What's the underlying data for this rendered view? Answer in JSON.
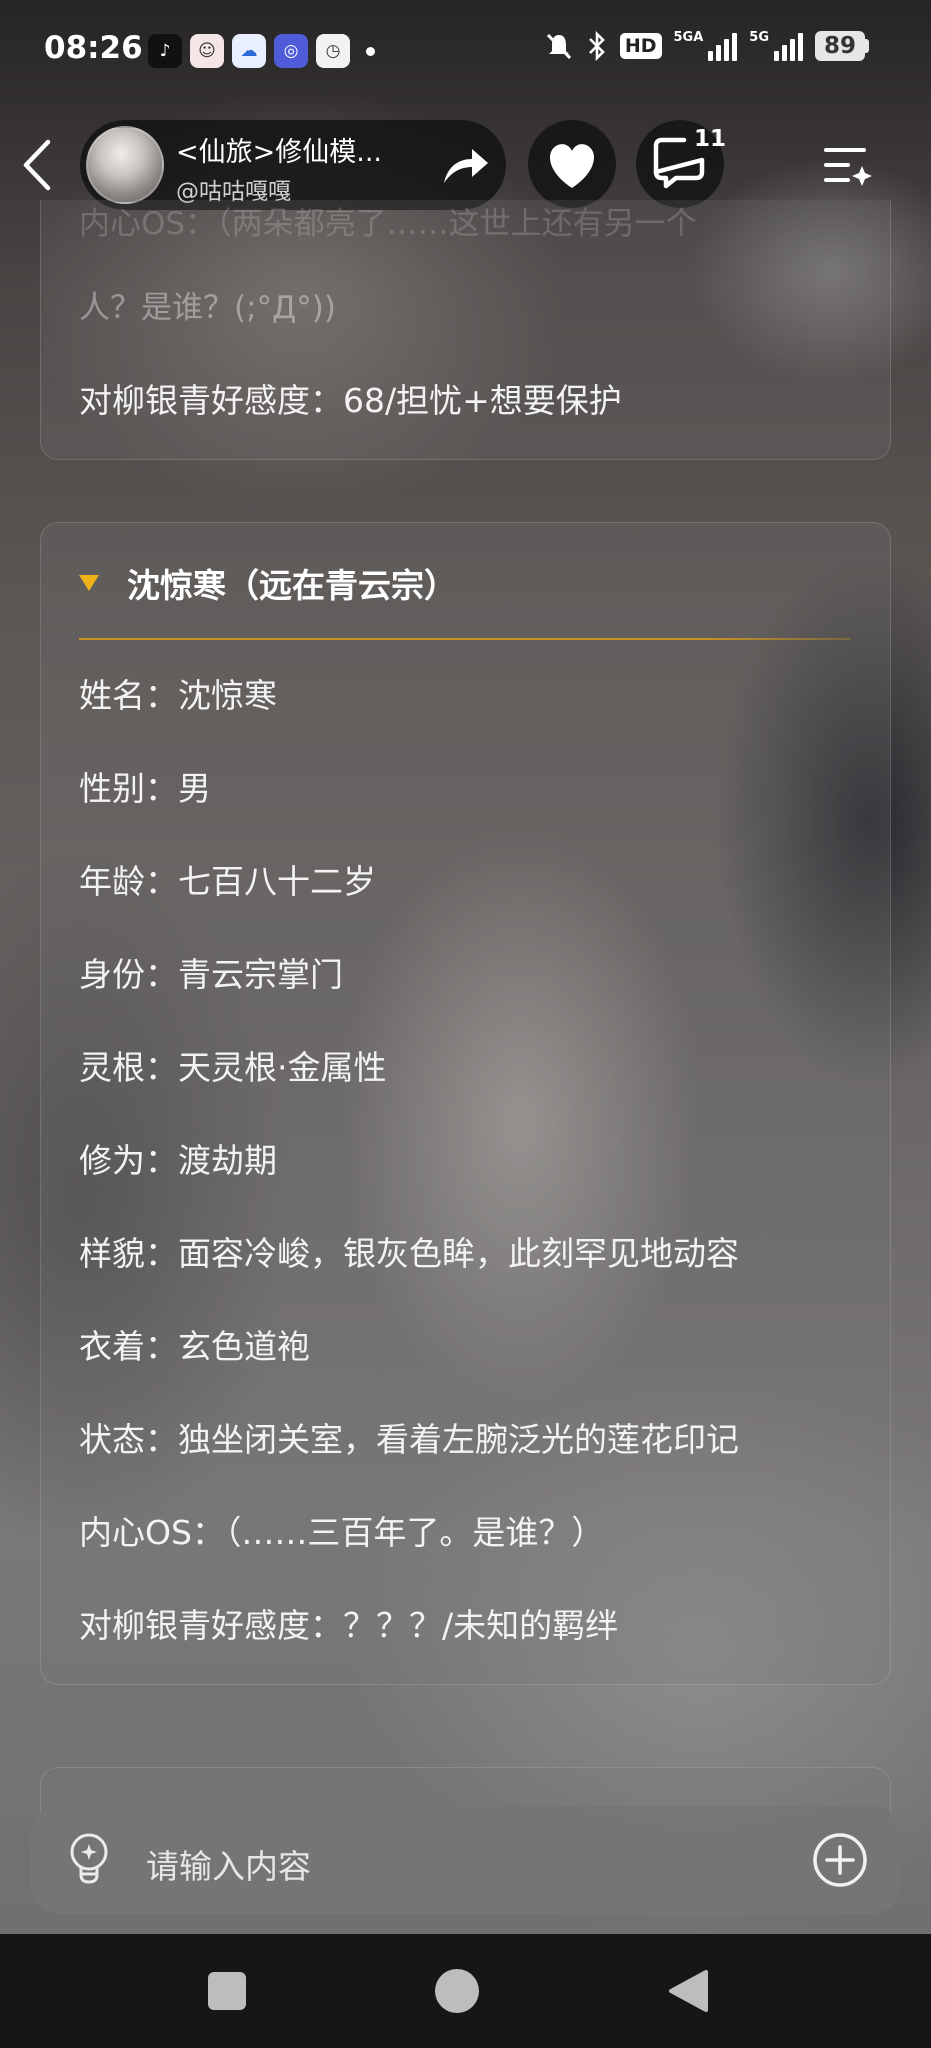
{
  "status_bar": {
    "time": "08:26",
    "hd": "HD",
    "net_a": "5GA",
    "net_b": "5G",
    "battery": "89"
  },
  "header": {
    "story_title": "<仙旅>修仙模...",
    "author": "@咕咕嘎嘎",
    "comment_count": "11"
  },
  "previous_card": {
    "faded_line_1": "内心OS：（两朵都亮了……这世上还有另一个",
    "faded_line_2": "人？是谁？(;°Д°))",
    "favor": "对柳银青好感度：68/担忧+想要保护"
  },
  "character_card": {
    "title": "沈惊寒（远在青云宗）",
    "rows": [
      "姓名：沈惊寒",
      "性别：男",
      "年龄：七百八十二岁",
      "身份：青云宗掌门",
      "灵根：天灵根·金属性",
      "修为：渡劫期",
      "样貌：面容冷峻，银灰色眸，此刻罕见地动容",
      "衣着：玄色道袍",
      "状态：独坐闭关室，看着左腕泛光的莲花印记",
      "内心OS：（……三百年了。是谁？）",
      "对柳银青好感度：？？？/未知的羁绊"
    ]
  },
  "input": {
    "placeholder": "请输入内容"
  },
  "colors": {
    "accent_gold": "#f0b21a",
    "pill_bg": "#121214"
  }
}
